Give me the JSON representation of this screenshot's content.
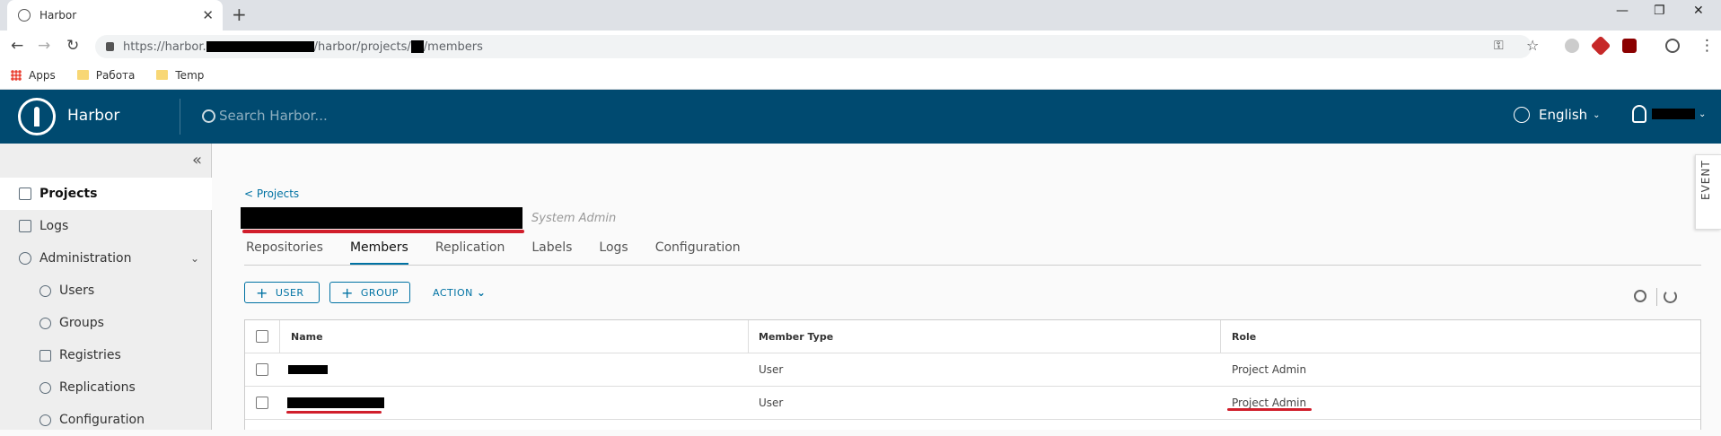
{
  "browser": {
    "tab_title": "Harbor",
    "url_prefix": "https://harbor.",
    "url_mid": "/harbor/projects/",
    "url_suffix": "/members",
    "bookmarks": [
      {
        "label": "Apps",
        "icon": "apps-grid-icon"
      },
      {
        "label": "Работа",
        "icon": "folder-icon"
      },
      {
        "label": "Temp",
        "icon": "folder-icon"
      }
    ]
  },
  "header": {
    "brand": "Harbor",
    "search_placeholder": "Search Harbor...",
    "language": "English",
    "accent_color": "#004a70"
  },
  "sidebar": {
    "items": [
      {
        "label": "Projects",
        "icon": "projects-icon"
      },
      {
        "label": "Logs",
        "icon": "logs-icon"
      },
      {
        "label": "Administration",
        "icon": "administration-icon"
      },
      {
        "label": "Users",
        "icon": "users-icon"
      },
      {
        "label": "Groups",
        "icon": "groups-icon"
      },
      {
        "label": "Registries",
        "icon": "registries-icon"
      },
      {
        "label": "Replications",
        "icon": "replications-icon"
      },
      {
        "label": "Configuration",
        "icon": "configuration-icon"
      }
    ]
  },
  "main": {
    "breadcrumb": "< Projects",
    "role_label": "System Admin",
    "tabs": [
      "Repositories",
      "Members",
      "Replication",
      "Labels",
      "Logs",
      "Configuration"
    ],
    "active_tab": "Members",
    "buttons": {
      "user": "USER",
      "group": "GROUP",
      "action": "ACTION"
    },
    "event_panel": "EVENT",
    "grid": {
      "columns": [
        "Name",
        "Member Type",
        "Role"
      ],
      "rows": [
        {
          "member_type": "User",
          "role": "Project Admin"
        },
        {
          "member_type": "User",
          "role": "Project Admin"
        }
      ]
    }
  }
}
